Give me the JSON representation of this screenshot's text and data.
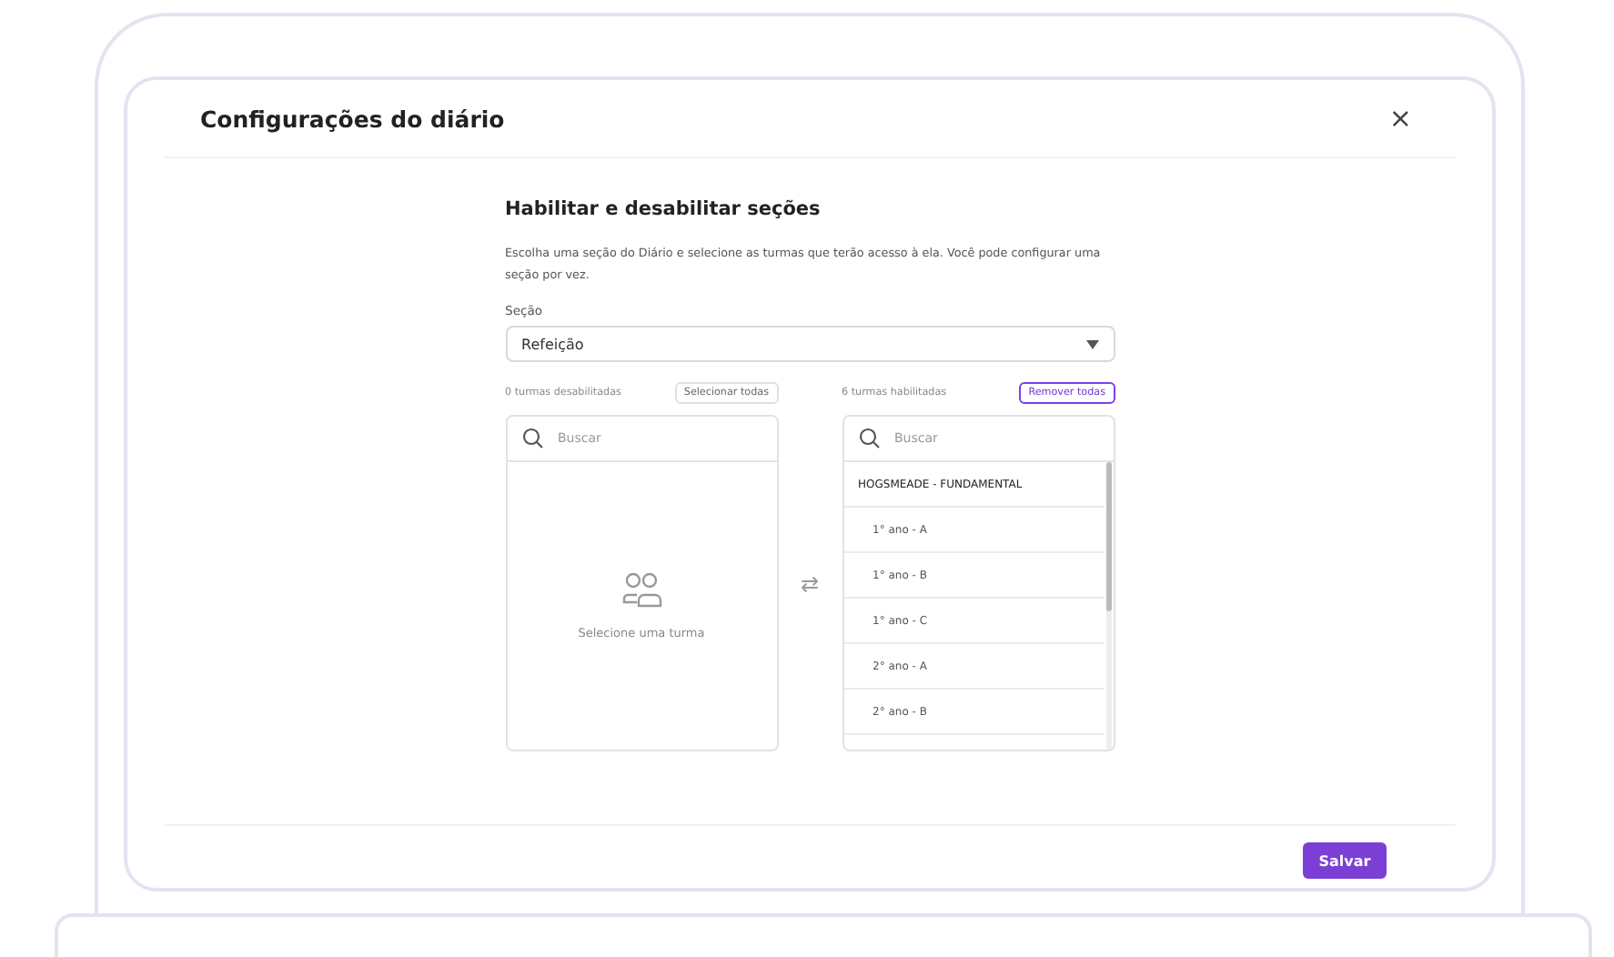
{
  "dialog": {
    "title": "Configurações do diário",
    "close": "×"
  },
  "section": {
    "heading": "Habilitar e desabilitar seções",
    "description": "Escolha uma seção do Diário e selecione as turmas que terão acesso à ela. Você pode configurar uma seção por vez.",
    "field_label": "Seção",
    "value": "Refeição"
  },
  "disabled_list": {
    "count": "0 turmas desabilitadas",
    "action": "Selecionar todas",
    "search_placeholder": "Buscar",
    "empty_text": "Selecione uma turma"
  },
  "transfer": "⇄",
  "enabled_list": {
    "count": "6 turmas habilitadas",
    "action": "Remover todas",
    "search_placeholder": "Buscar",
    "groups": [
      {
        "name": "HOGSMEADE - FUNDAMENTAL",
        "children": [
          {
            "name": "1° ano - A"
          },
          {
            "name": "1° ano - B"
          },
          {
            "name": "1° ano - C"
          },
          {
            "name": "2° ano - A"
          },
          {
            "name": "2° ano - B"
          }
        ]
      }
    ]
  },
  "save": "Salvar"
}
